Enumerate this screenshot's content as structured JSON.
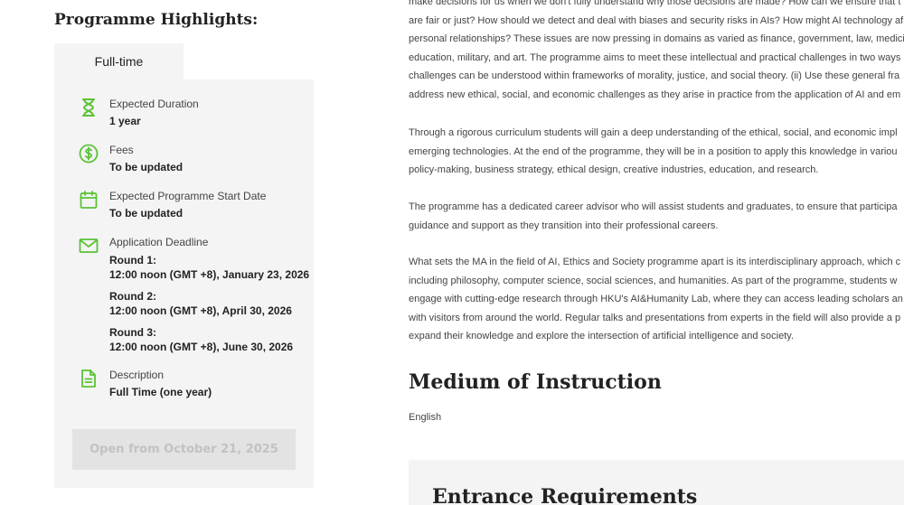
{
  "highlights": {
    "title": "Programme Highlights:",
    "tab_label": "Full-time",
    "items": [
      {
        "icon": "hourglass-icon",
        "label": "Expected Duration",
        "value": "1 year"
      },
      {
        "icon": "dollar-icon",
        "label": "Fees",
        "value": "To be updated"
      },
      {
        "icon": "calendar-icon",
        "label": "Expected Programme Start Date",
        "value": "To be updated"
      },
      {
        "icon": "mail-icon",
        "label": "Application Deadline",
        "rounds": [
          {
            "title": "Round 1:",
            "date": "12:00 noon (GMT +8), January 23, 2026"
          },
          {
            "title": "Round 2:",
            "date": "12:00 noon (GMT +8), April 30, 2026"
          },
          {
            "title": "Round 3:",
            "date": "12:00 noon (GMT +8), June 30, 2026"
          }
        ]
      },
      {
        "icon": "document-icon",
        "label": "Description",
        "value": "Full Time (one year)"
      }
    ],
    "open_button": "Open from October 21, 2025"
  },
  "content": {
    "paragraphs": [
      [
        "make decisions for us when we don't fully understand why those decisions are made? How can we ensure that t",
        "are fair or just? How should we detect and deal with biases and security risks in AIs? How might AI technology af",
        "personal relationships? These issues are now pressing in domains as varied as finance, government, law, medici",
        "education, military, and art. The programme aims to meet these intellectual and practical challenges in two ways",
        "challenges can be understood within frameworks of morality, justice, and social theory. (ii) Use these general fra",
        "address new ethical, social, and economic challenges as they arise in practice from the application of AI and em"
      ],
      [
        "Through a rigorous curriculum students will gain a deep understanding of the ethical, social, and economic impl",
        "emerging technologies. At the end of the programme, they will be in a position to apply this knowledge in variou",
        "policy-making, business strategy, ethical design, creative industries, education, and research."
      ],
      [
        "The programme has a dedicated career advisor who will assist students and graduates, to ensure that participa",
        "guidance and support as they transition into their professional careers."
      ],
      [
        "What sets the MA in the field of AI, Ethics and Society programme apart is its interdisciplinary approach, which c",
        "including philosophy, computer science, social sciences, and humanities. As part of the programme, students w",
        "engage with cutting-edge research through HKU's AI&Humanity Lab, where they can access leading scholars an",
        "with visitors from around the world. Regular talks and presentations from experts in the field will also provide a p",
        "expand their knowledge and explore the intersection of artificial intelligence and society."
      ]
    ],
    "medium_title": "Medium of Instruction",
    "medium_value": "English",
    "entry_title": "Entrance Requirements"
  },
  "colors": {
    "accent": "#5bc236",
    "panel": "#f4f4f4",
    "button_bg": "#e3e3e3",
    "button_text": "#c2c2c2"
  }
}
